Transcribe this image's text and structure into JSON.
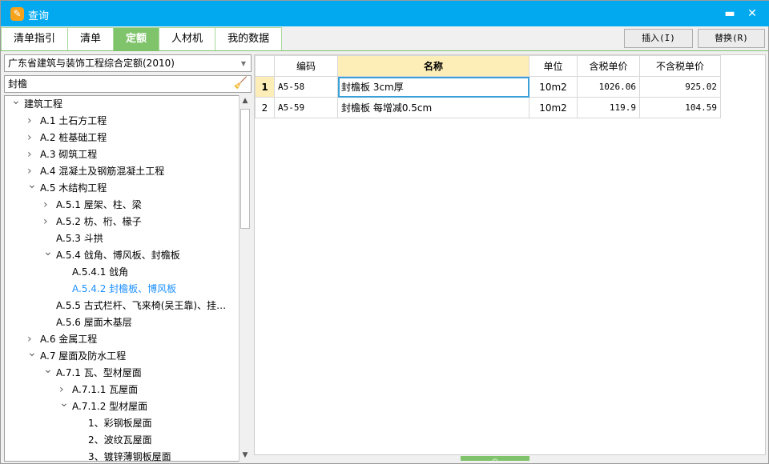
{
  "window": {
    "title": "查询",
    "icon": "app-logo-icon",
    "minimize": "▬",
    "close": "✕"
  },
  "tabs": [
    {
      "label": "清单指引"
    },
    {
      "label": "清单"
    },
    {
      "label": "定额",
      "active": true
    },
    {
      "label": "人材机"
    },
    {
      "label": "我的数据"
    }
  ],
  "toolbar": {
    "insert_label": "插入(I)",
    "replace_label": "替换(R)"
  },
  "library": {
    "selected": "广东省建筑与装饰工程综合定额(2010)"
  },
  "search": {
    "value": "封檐",
    "clear_icon": "broom-icon"
  },
  "tree": [
    {
      "level": 0,
      "state": "open",
      "label": "建筑工程"
    },
    {
      "level": 1,
      "state": "closed",
      "label": "A.1 土石方工程"
    },
    {
      "level": 1,
      "state": "closed",
      "label": "A.2 桩基础工程"
    },
    {
      "level": 1,
      "state": "closed",
      "label": "A.3 砌筑工程"
    },
    {
      "level": 1,
      "state": "closed",
      "label": "A.4 混凝土及钢筋混凝土工程"
    },
    {
      "level": 1,
      "state": "open",
      "label": "A.5 木结构工程"
    },
    {
      "level": 2,
      "state": "closed",
      "label": "A.5.1 屋架、柱、梁"
    },
    {
      "level": 2,
      "state": "closed",
      "label": "A.5.2 枋、桁、椽子"
    },
    {
      "level": 2,
      "state": "leaf",
      "label": "A.5.3 斗拱"
    },
    {
      "level": 2,
      "state": "open",
      "label": "A.5.4 戗角、博风板、封檐板"
    },
    {
      "level": 3,
      "state": "leaf",
      "label": "A.5.4.1 戗角"
    },
    {
      "level": 3,
      "state": "leaf",
      "label": "A.5.4.2 封檐板、博风板",
      "selected": true
    },
    {
      "level": 2,
      "state": "leaf",
      "label": "A.5.5 古式栏杆、飞来椅(吴王靠)、挂…"
    },
    {
      "level": 2,
      "state": "leaf",
      "label": "A.5.6 屋面木基层"
    },
    {
      "level": 1,
      "state": "closed",
      "label": "A.6 金属工程"
    },
    {
      "level": 1,
      "state": "open",
      "label": "A.7 屋面及防水工程"
    },
    {
      "level": 2,
      "state": "open",
      "label": "A.7.1 瓦、型材屋面"
    },
    {
      "level": 3,
      "state": "closed",
      "label": "A.7.1.1 瓦屋面"
    },
    {
      "level": 3,
      "state": "open",
      "label": "A.7.1.2 型材屋面"
    },
    {
      "level": 4,
      "state": "leaf",
      "label": "1、彩钢板屋面"
    },
    {
      "level": 4,
      "state": "leaf",
      "label": "2、波纹瓦屋面"
    },
    {
      "level": 4,
      "state": "leaf",
      "label": "3、镀锌薄钢板屋面"
    }
  ],
  "table": {
    "headers": [
      "编码",
      "名称",
      "单位",
      "含税单价",
      "不含税单价"
    ],
    "rows": [
      {
        "n": "1",
        "code": "A5-58",
        "name": "封檐板 3cm厚",
        "unit": "10m2",
        "tax": "1026.06",
        "notax": "925.02"
      },
      {
        "n": "2",
        "code": "A5-59",
        "name": "封檐板 每增减0.5cm",
        "unit": "10m2",
        "tax": "119.9",
        "notax": "104.59"
      }
    ]
  },
  "colors": {
    "titlebar": "#03a9ef",
    "accent": "#7fc36b",
    "selected_text": "#1e90ff",
    "header_highlight": "#fdeeb7"
  }
}
